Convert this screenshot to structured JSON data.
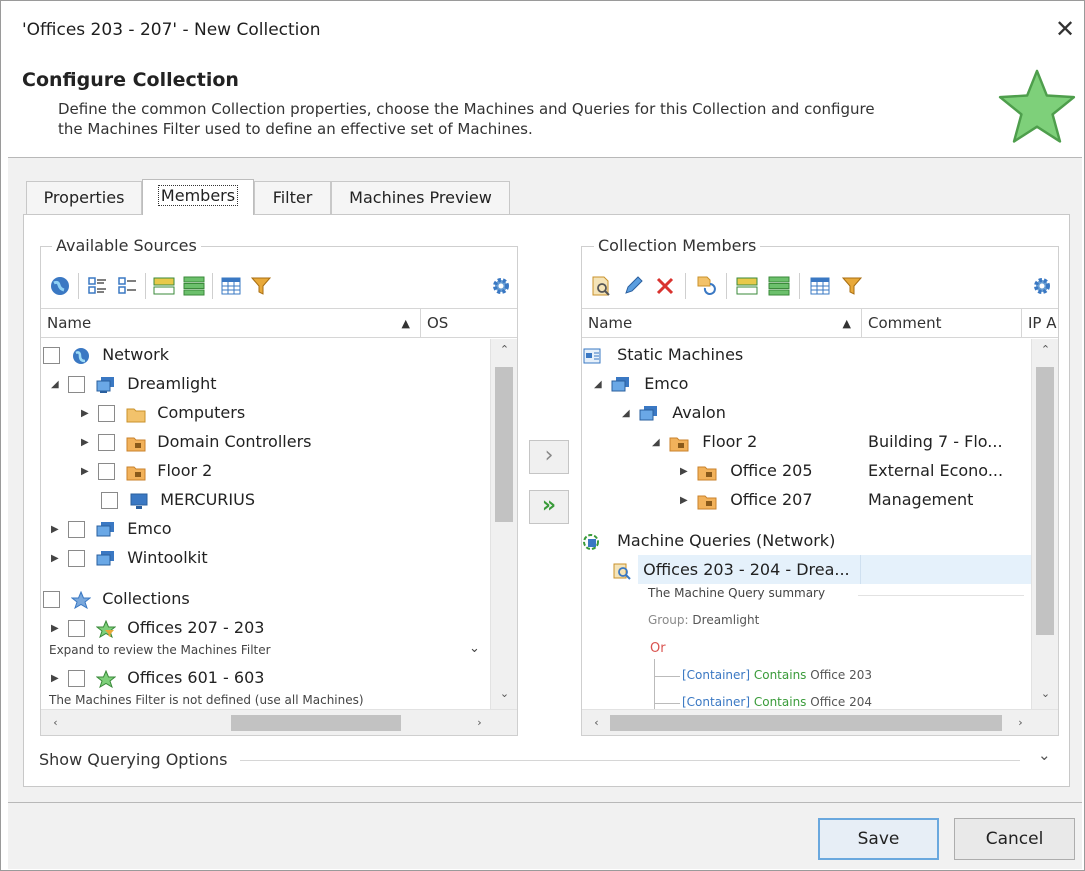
{
  "window": {
    "title": "'Offices 203 - 207' - New Collection"
  },
  "header": {
    "title": "Configure Collection",
    "desc_line1": "Define the common Collection properties, choose the Machines and Queries for this Collection and configure",
    "desc_line2": "the Machines Filter used to define an effective set of Machines."
  },
  "tabs": [
    "Properties",
    "Members",
    "Filter",
    "Machines Preview"
  ],
  "available": {
    "title": "Available Sources",
    "columns": [
      "Name",
      "OS"
    ],
    "items": {
      "network": "Network",
      "dreamlight": "Dreamlight",
      "computers": "Computers",
      "domain_controllers": "Domain Controllers",
      "floor2": "Floor 2",
      "mercurius": "MERCURIUS",
      "emco": "Emco",
      "wintoolkit": "Wintoolkit",
      "collections": "Collections",
      "offices_207_203": "Offices 207 - 203",
      "offices_207_203_note": "Expand to review the Machines Filter",
      "offices_601_603": "Offices 601 - 603",
      "offices_601_603_note": "The Machines Filter is not defined (use all Machines)"
    }
  },
  "members": {
    "title": "Collection Members",
    "columns": [
      "Name",
      "Comment",
      "IP A"
    ],
    "items": {
      "static": "Static Machines",
      "emco": "Emco",
      "avalon": "Avalon",
      "floor2": "Floor 2",
      "floor2_comment": "Building 7 - Flo...",
      "office205": "Office 205",
      "office205_comment": "External Econo...",
      "office207": "Office 207",
      "office207_comment": "Management",
      "queries": "Machine Queries (Network)",
      "query1": "Offices 203 - 204 - Drea...",
      "summary": "The Machine Query summary",
      "group_label": "Group:",
      "group_value": "Dreamlight",
      "or": "Or",
      "cond1_tag": "[Container]",
      "cond1_op": "Contains",
      "cond1_val": "Office 203",
      "cond2_tag": "[Container]",
      "cond2_op": "Contains",
      "cond2_val": "Office 204"
    }
  },
  "show_querying": "Show Querying Options",
  "buttons": {
    "save": "Save",
    "cancel": "Cancel"
  },
  "colors": {
    "accent": "#3a78c3",
    "star": "#7ed07a",
    "green_text": "#3a9b3a",
    "or_red": "#d9534f"
  }
}
